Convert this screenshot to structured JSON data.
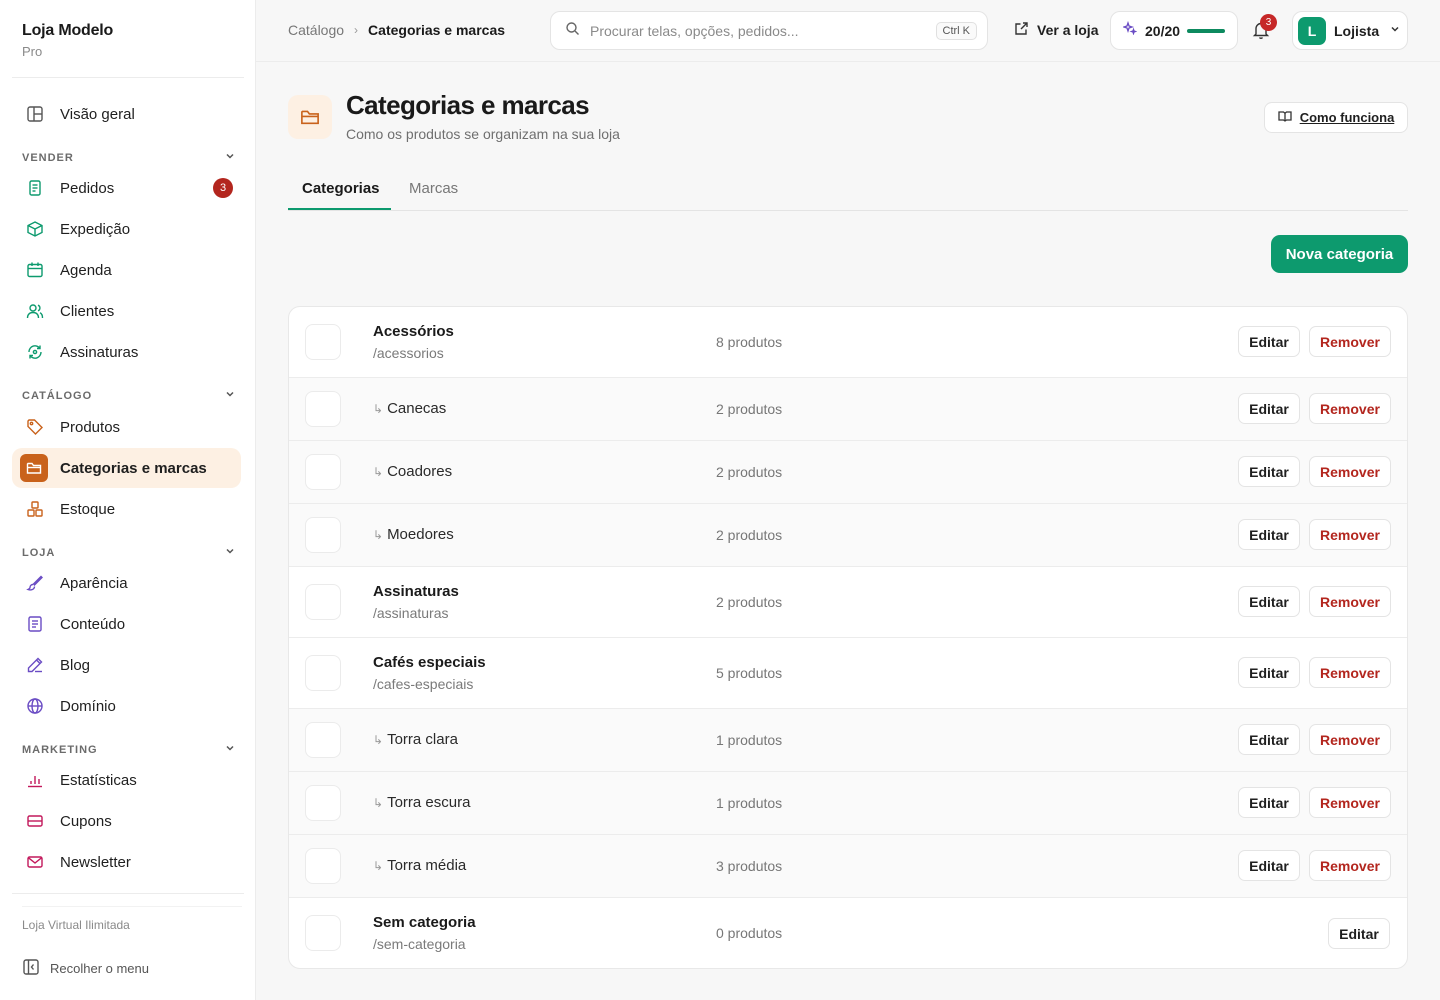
{
  "brand": {
    "name": "Loja Modelo",
    "plan": "Pro"
  },
  "sidebar": {
    "overview": "Visão geral",
    "sections": {
      "sell": "VENDER",
      "catalog": "CATÁLOGO",
      "store": "LOJA",
      "marketing": "MARKETING"
    },
    "items": {
      "orders": "Pedidos",
      "orders_badge": "3",
      "shipping": "Expedição",
      "schedule": "Agenda",
      "customers": "Clientes",
      "subscriptions": "Assinaturas",
      "products": "Produtos",
      "categories": "Categorias e marcas",
      "stock": "Estoque",
      "appearance": "Aparência",
      "content": "Conteúdo",
      "blog": "Blog",
      "domain": "Domínio",
      "stats": "Estatísticas",
      "coupons": "Cupons",
      "newsletter": "Newsletter"
    },
    "footer_note": "Loja Virtual Ilimitada",
    "collapse": "Recolher o menu"
  },
  "topbar": {
    "breadcrumb": [
      "Catálogo",
      "Categorias e marcas"
    ],
    "search_placeholder": "Procurar telas, opções, pedidos...",
    "shortcut": "Ctrl K",
    "view_store": "Ver a loja",
    "quota": "20/20",
    "quota_fraction": 1.0,
    "notifications": "3",
    "avatar_letter": "L",
    "user": "Lojista"
  },
  "page": {
    "title": "Categorias e marcas",
    "subtitle": "Como os produtos se organizam na sua loja",
    "how_it_works": "Como funciona"
  },
  "tabs": [
    "Categorias",
    "Marcas"
  ],
  "new_category": "Nova categoria",
  "actions": {
    "edit": "Editar",
    "remove": "Remover"
  },
  "categories": [
    {
      "name": "Acessórios",
      "slug": "/acessorios",
      "count": "8 produtos",
      "child": false,
      "removable": true
    },
    {
      "name": "Canecas",
      "slug": "",
      "count": "2 produtos",
      "child": true,
      "removable": true
    },
    {
      "name": "Coadores",
      "slug": "",
      "count": "2 produtos",
      "child": true,
      "removable": true
    },
    {
      "name": "Moedores",
      "slug": "",
      "count": "2 produtos",
      "child": true,
      "removable": true
    },
    {
      "name": "Assinaturas",
      "slug": "/assinaturas",
      "count": "2 produtos",
      "child": false,
      "removable": true
    },
    {
      "name": "Cafés especiais",
      "slug": "/cafes-especiais",
      "count": "5 produtos",
      "child": false,
      "removable": true
    },
    {
      "name": "Torra clara",
      "slug": "",
      "count": "1 produtos",
      "child": true,
      "removable": true
    },
    {
      "name": "Torra escura",
      "slug": "",
      "count": "1 produtos",
      "child": true,
      "removable": true
    },
    {
      "name": "Torra média",
      "slug": "",
      "count": "3 produtos",
      "child": true,
      "removable": true
    },
    {
      "name": "Sem categoria",
      "slug": "/sem-categoria",
      "count": "0 produtos",
      "child": false,
      "removable": false
    }
  ],
  "colors": {
    "accent": "#0d9a6e",
    "brand_orange": "#c9621b",
    "danger": "#b3261e"
  }
}
